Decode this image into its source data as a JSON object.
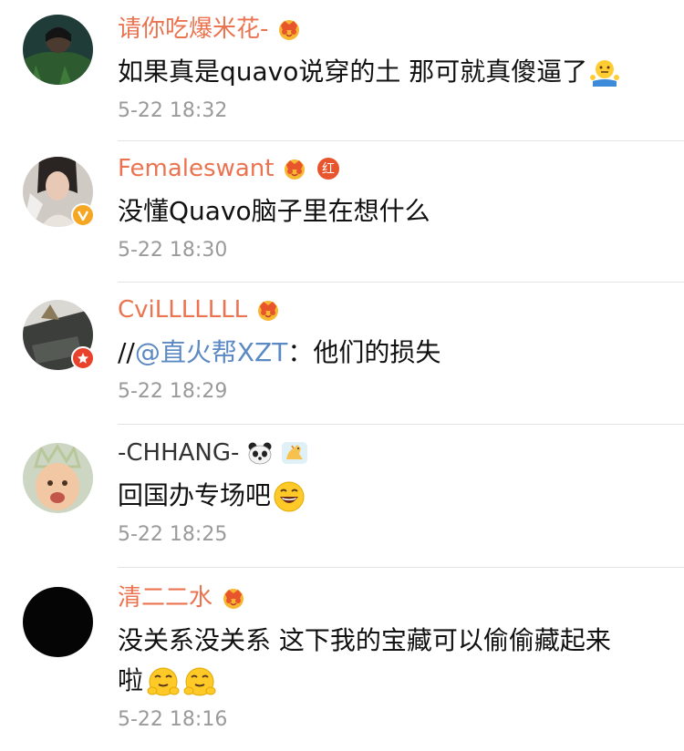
{
  "colors": {
    "username": "#eb7350",
    "mention": "#5b89c3",
    "timestamp": "#9a9a9a",
    "text": "#111111",
    "divider": "#e4e4e4"
  },
  "comments": [
    {
      "username": "请你吃爆米花-",
      "badges": [
        "crown-vip-icon"
      ],
      "text": "如果真是quavo说穿的土 那可就真傻逼了",
      "trailing_emoji": "shrug-emoji",
      "time": "5-22 18:32"
    },
    {
      "username": "Femaleswant",
      "badges": [
        "crown-vip-icon",
        "hong-red-badge-icon"
      ],
      "hong_label": "红",
      "avatar_badge": "verified-yellow-icon",
      "text": "没懂Quavo脑子里在想什么",
      "time": "5-22 18:30"
    },
    {
      "username": "CviLLLLLLL",
      "badges": [
        "crown-vip-icon"
      ],
      "avatar_badge": "verified-red-icon",
      "text_prefix": "//",
      "mention": "@直火帮XZT",
      "text_suffix": "：他们的损失",
      "time": "5-22 18:29"
    },
    {
      "username": "-CHHANG-",
      "badges": [
        "panda-icon",
        "horse-icon"
      ],
      "text": "回国办专场吧",
      "trailing_emoji": "laugh-emoji",
      "time": "5-22 18:25"
    },
    {
      "username": "清二二水",
      "badges": [
        "crown-vip-icon"
      ],
      "text_line1": "没关系没关系 这下我的宝藏可以偷偷藏起来",
      "text_line2": "啦",
      "trailing_emojis": [
        "smug-emoji",
        "smug-emoji"
      ],
      "time": "5-22 18:16"
    }
  ]
}
